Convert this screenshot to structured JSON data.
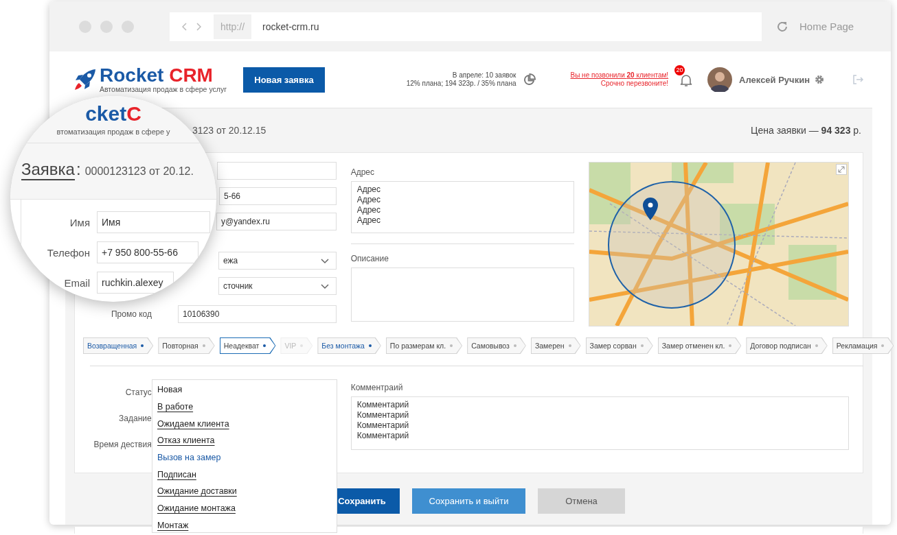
{
  "browser": {
    "url_scheme": "http://",
    "url": "rocket-crm.ru",
    "home": "Home Page"
  },
  "header": {
    "logo": {
      "word1": "Rocket",
      "word2": "CRM",
      "tagline": "Автоматизация продаж в сфере услуг"
    },
    "new_button": "Новая заявка",
    "stats": [
      "В апреле: 10 заявок",
      "12% плана; 194 323р. / 35% плана"
    ],
    "alert": [
      "Вы не позвонили **20** клиентам!",
      "Срочно перезвоните!"
    ],
    "notifications": "20",
    "user": "Алексей Ручкин"
  },
  "order": {
    "title_fragment": "3123 от 20.12.15",
    "price": "Цена заявки — **94 323** р."
  },
  "fields": [
    {
      "kind": "input"
    },
    {
      "kind": "input",
      "value": "5-66"
    },
    {
      "kind": "input",
      "value": "y@yandex.ru"
    },
    {
      "kind": "select",
      "value": "ежа"
    },
    {
      "kind": "select",
      "value": "сточник"
    },
    {
      "kind": "input",
      "label": "Промо код",
      "value": "10106390"
    }
  ],
  "address": {
    "label": "Адрес",
    "lines": [
      "Адрес",
      "Адрес",
      "Адрес",
      "Адрес"
    ]
  },
  "description": {
    "label": "Описание"
  },
  "map": {
    "kind": "picture"
  },
  "tags": [
    {
      "label": "Возвращенная",
      "active": true,
      "selected": false,
      "disabled": false
    },
    {
      "label": "Повторная",
      "active": false,
      "selected": false,
      "disabled": false
    },
    {
      "label": "Неадекват",
      "active": false,
      "selected": true,
      "disabled": false
    },
    {
      "label": "VIP",
      "active": false,
      "selected": false,
      "disabled": true
    },
    {
      "label": "Без монтажа",
      "active": true,
      "selected": false,
      "disabled": false
    },
    {
      "label": "По размерам кл.",
      "active": false,
      "selected": false,
      "disabled": false
    },
    {
      "label": "Самовывоз",
      "active": false,
      "selected": false,
      "disabled": false
    },
    {
      "label": "Замерен",
      "active": false,
      "selected": false,
      "disabled": false
    },
    {
      "label": "Замер сорван",
      "active": false,
      "selected": false,
      "disabled": false
    },
    {
      "label": "Замер отменен кл.",
      "active": false,
      "selected": false,
      "disabled": false
    },
    {
      "label": "Договор подписан",
      "active": false,
      "selected": false,
      "disabled": false
    },
    {
      "label": "Рекламация",
      "active": false,
      "selected": false,
      "disabled": false
    }
  ],
  "task_labels": [
    "Статус",
    "Задание",
    "Время дествия"
  ],
  "status_options": [
    {
      "label": "Новая",
      "current": true,
      "selected": false
    },
    {
      "label": "В работе",
      "current": false,
      "selected": false
    },
    {
      "label": "Ожидаем клиента",
      "current": false,
      "selected": false
    },
    {
      "label": "Отказ клиента",
      "current": false,
      "selected": false
    },
    {
      "label": "Вызов на замер",
      "current": false,
      "selected": true
    },
    {
      "label": "Подписан",
      "current": false,
      "selected": false
    },
    {
      "label": "Ожидание доставки",
      "current": false,
      "selected": false
    },
    {
      "label": "Ожидание монтажа",
      "current": false,
      "selected": false
    },
    {
      "label": "Монтаж",
      "current": false,
      "selected": false
    }
  ],
  "comment": {
    "label": "Комментраий",
    "lines": [
      "Комментарий",
      "Комментарий",
      "Комментарий",
      "Комментарий"
    ]
  },
  "buttons": [
    {
      "kind": "primary",
      "label": "Сохранить"
    },
    {
      "kind": "secondary",
      "label": "Сохранить и выйти"
    },
    {
      "kind": "cancel",
      "label": "Отмена"
    }
  ],
  "magnifier": {
    "logo_fragment": "cket",
    "logo_fragment_2": "C",
    "tagline_fragment": "втоматизация продаж в сфере у",
    "title": "Заявка",
    "title_separator": ":",
    "number": "0000123123 от 20.12.",
    "fields": [
      {
        "label": "Имя",
        "value": "Имя"
      },
      {
        "label": "Телефон",
        "value": "+7 950 800-55-66"
      },
      {
        "label": "Email",
        "value": "ruchkin.alexey"
      }
    ]
  }
}
